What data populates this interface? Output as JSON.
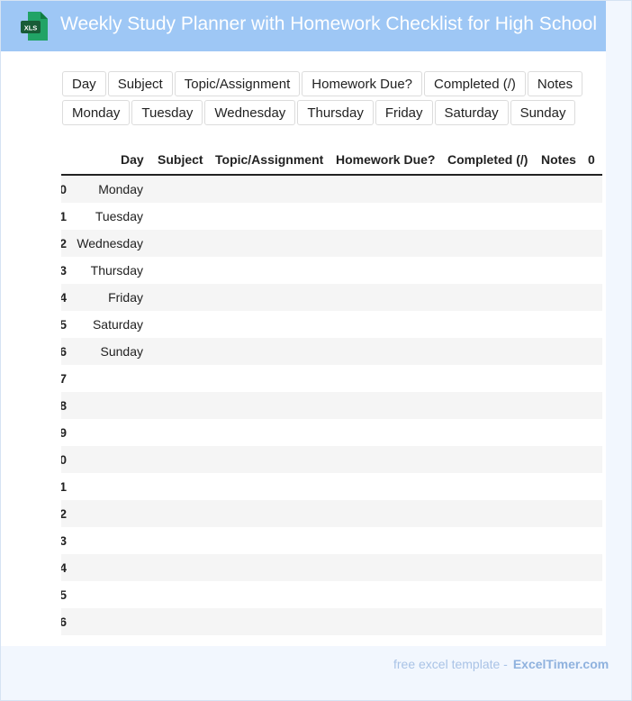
{
  "header": {
    "icon": "xls-file-icon",
    "icon_text": "XLS",
    "title": "Weekly Study Planner with Homework Checklist for High School"
  },
  "columns": [
    "Day",
    "Subject",
    "Topic/Assignment",
    "Homework Due?",
    "Completed (/)",
    "Notes"
  ],
  "days": [
    "Monday",
    "Tuesday",
    "Wednesday",
    "Thursday",
    "Friday",
    "Saturday",
    "Sunday"
  ],
  "table": {
    "headers": [
      "Day",
      "Subject",
      "Topic/Assignment",
      "Homework Due?",
      "Completed (/)",
      "Notes",
      "0"
    ],
    "row_index_digits": [
      "0",
      "1",
      "2",
      "3",
      "4",
      "5",
      "6",
      "7",
      "8",
      "9",
      "0",
      "1",
      "2",
      "3",
      "4",
      "5",
      "6"
    ],
    "day_cells": [
      "Monday",
      "Tuesday",
      "Wednesday",
      "Thursday",
      "Friday",
      "Saturday",
      "Sunday",
      "",
      "",
      "",
      "",
      "",
      "",
      "",
      "",
      "",
      ""
    ]
  },
  "footer": {
    "text": "free excel template -",
    "brand": "ExcelTimer.com"
  },
  "colors": {
    "header_bg": "#9ec7f5",
    "page_bg": "#f2f7fe",
    "icon_green": "#1e7d45"
  }
}
